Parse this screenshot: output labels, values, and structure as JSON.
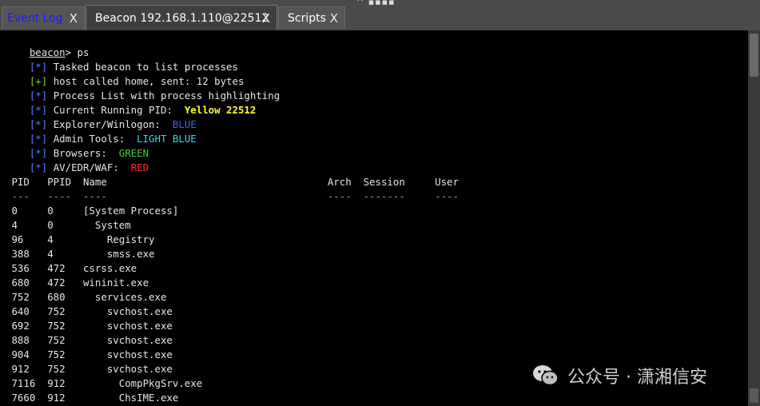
{
  "tabs": [
    {
      "label": "Event Log",
      "close": "X"
    },
    {
      "label": "Beacon 192.168.1.110@22512",
      "close": "X"
    },
    {
      "label": "Scripts",
      "close": "X"
    }
  ],
  "grip": "^ ▪▪▪▪ ˅",
  "console": {
    "prompt_user": "beacon",
    "prompt_cmd": "> ps",
    "messages": [
      {
        "tag": "[*]",
        "text": "Tasked beacon to list processes",
        "highlight": ""
      },
      {
        "tag": "[+]",
        "text": "host called home, sent: 12 bytes",
        "highlight": ""
      },
      {
        "tag": "[*]",
        "text": "Process List with process highlighting",
        "highlight": ""
      },
      {
        "tag": "[*]",
        "text": "Current Running PID:  ",
        "highlight": "Yellow 22512"
      },
      {
        "tag": "[*]",
        "text": "Explorer/Winlogon:  ",
        "highlight": "BLUE"
      },
      {
        "tag": "[*]",
        "text": "Admin Tools:  ",
        "highlight": "LIGHT BLUE"
      },
      {
        "tag": "[*]",
        "text": "Browsers:  ",
        "highlight": "GREEN"
      },
      {
        "tag": "[*]",
        "text": "AV/EDR/WAF:  ",
        "highlight": "RED"
      }
    ],
    "table_header": " PID   PPID  Name                                     Arch  Session     User",
    "table_sep": " ---   ----  ----                                     ----  -------     ----",
    "rows": [
      " 0     0     [System Process]",
      " 4     0       System",
      " 96    4         Registry",
      " 388   4         smss.exe",
      " 536   472   csrss.exe",
      " 680   472   wininit.exe",
      " 752   680     services.exe",
      " 640   752       svchost.exe",
      " 692   752       svchost.exe",
      " 888   752       svchost.exe",
      " 904   752       svchost.exe",
      " 912   752       svchost.exe",
      " 7116  912         CompPkgSrv.exe",
      " 7660  912         ChsIME.exe"
    ]
  },
  "watermark": {
    "text": "公众号 · 潇湘信安",
    "icon": "wechat-icon"
  }
}
